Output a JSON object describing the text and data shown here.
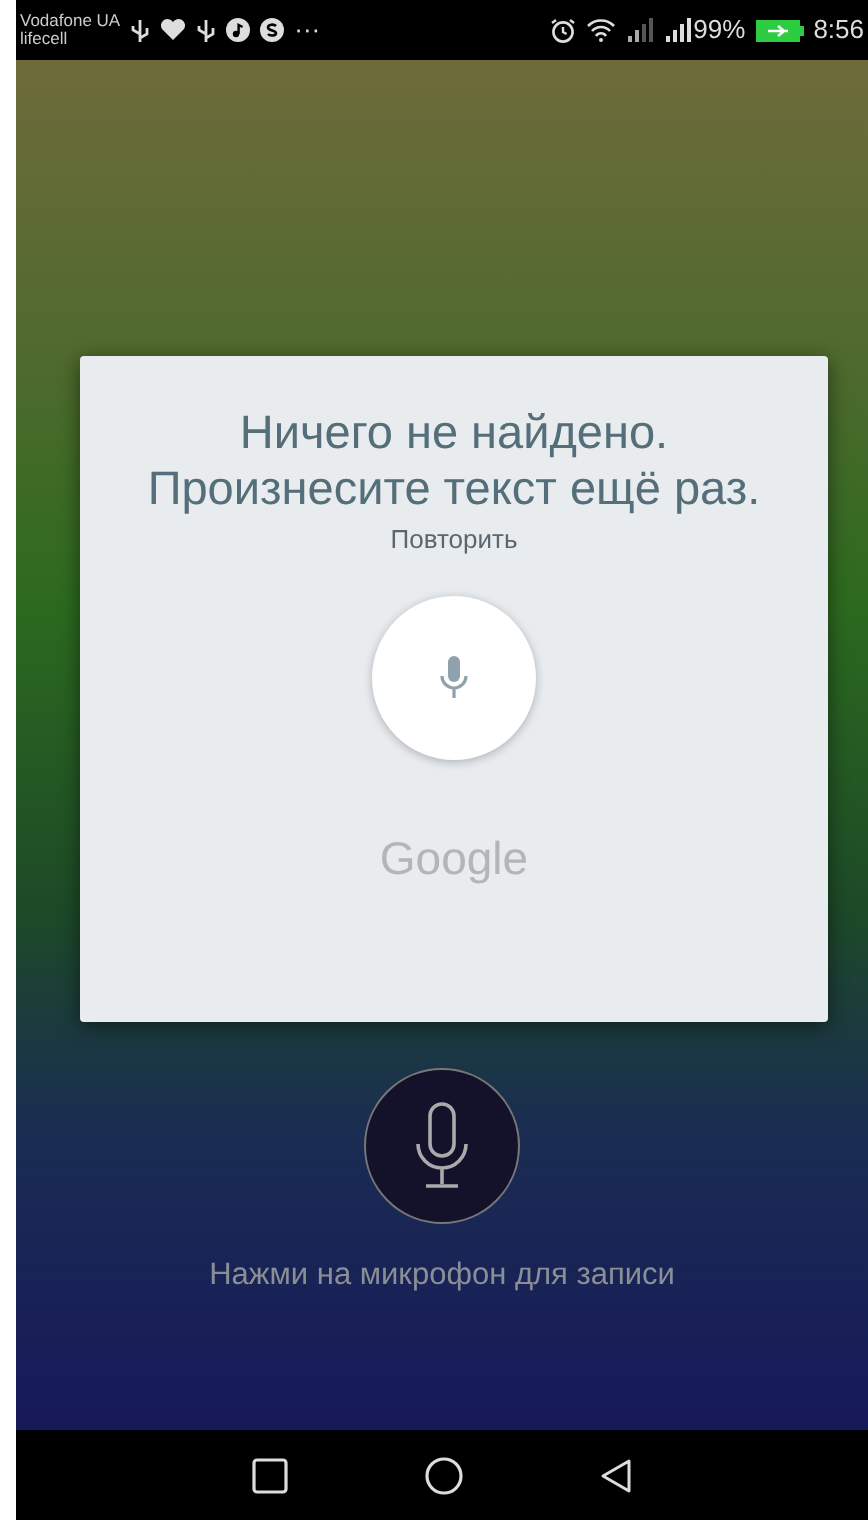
{
  "status_bar": {
    "carriers": [
      "Vodafone UA",
      "lifecell"
    ],
    "overflow": "···",
    "battery": "99%",
    "time": "8:56"
  },
  "screen": {
    "hint": "Нажми на микрофон для записи"
  },
  "dialog": {
    "message": "Ничего не найдено. Произнесите текст ещё раз.",
    "retry": "Повторить",
    "brand": "Google"
  }
}
